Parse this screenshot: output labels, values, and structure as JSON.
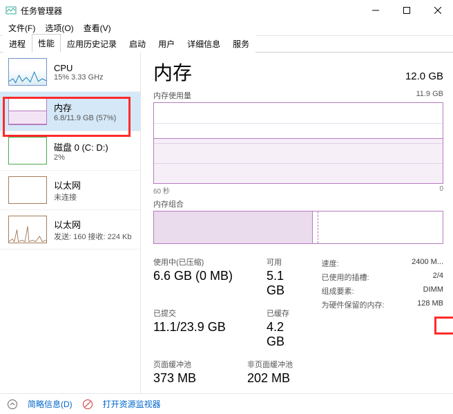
{
  "window": {
    "title": "任务管理器"
  },
  "menus": {
    "file": "文件(F)",
    "options": "选项(O)",
    "view": "查看(V)"
  },
  "tabs": [
    "进程",
    "性能",
    "应用历史记录",
    "启动",
    "用户",
    "详细信息",
    "服务"
  ],
  "active_tab": 1,
  "sidebar": {
    "items": [
      {
        "title": "CPU",
        "sub": "15% 3.33 GHz"
      },
      {
        "title": "内存",
        "sub": "6.8/11.9 GB (57%)"
      },
      {
        "title": "磁盘 0 (C: D:)",
        "sub": "2%"
      },
      {
        "title": "以太网",
        "sub": "未连接"
      },
      {
        "title": "以太网",
        "sub": "发送: 160 接收: 224 Kb"
      }
    ],
    "selected": 1
  },
  "main": {
    "title": "内存",
    "total": "12.0 GB",
    "usage_label": "内存使用量",
    "usage_max": "11.9 GB",
    "axis_left": "60 秒",
    "axis_right": "0",
    "comp_label": "内存组合",
    "stats": {
      "in_use_label": "使用中(已压缩)",
      "in_use": "6.6 GB (0 MB)",
      "avail_label": "可用",
      "avail": "5.1 GB",
      "committed_label": "已提交",
      "committed": "11.1/23.9 GB",
      "cached_label": "已缓存",
      "cached": "4.2 GB",
      "paged_label": "页面缓冲池",
      "paged": "373 MB",
      "nonpaged_label": "非页面缓冲池",
      "nonpaged": "202 MB"
    },
    "info": {
      "speed_k": "速度:",
      "speed_v": "2400 M...",
      "slots_k": "已使用的插槽:",
      "slots_v": "2/4",
      "form_k": "组成要素:",
      "form_v": "DIMM",
      "reserved_k": "为硬件保留的内存:",
      "reserved_v": "128 MB"
    }
  },
  "footer": {
    "fewer": "简略信息(D)",
    "resmon": "打开资源监视器"
  },
  "chart_data": {
    "type": "area",
    "title": "内存使用量",
    "ylabel": "GB",
    "ylim": [
      0,
      11.9
    ],
    "x_range_seconds": [
      60,
      0
    ],
    "series": [
      {
        "name": "使用中",
        "approx_constant_value": 6.7
      }
    ],
    "composition": {
      "total_gb": 11.9,
      "in_use_gb": 6.6,
      "modified_gb": 0.2,
      "standby_free_gb": 5.1
    }
  }
}
